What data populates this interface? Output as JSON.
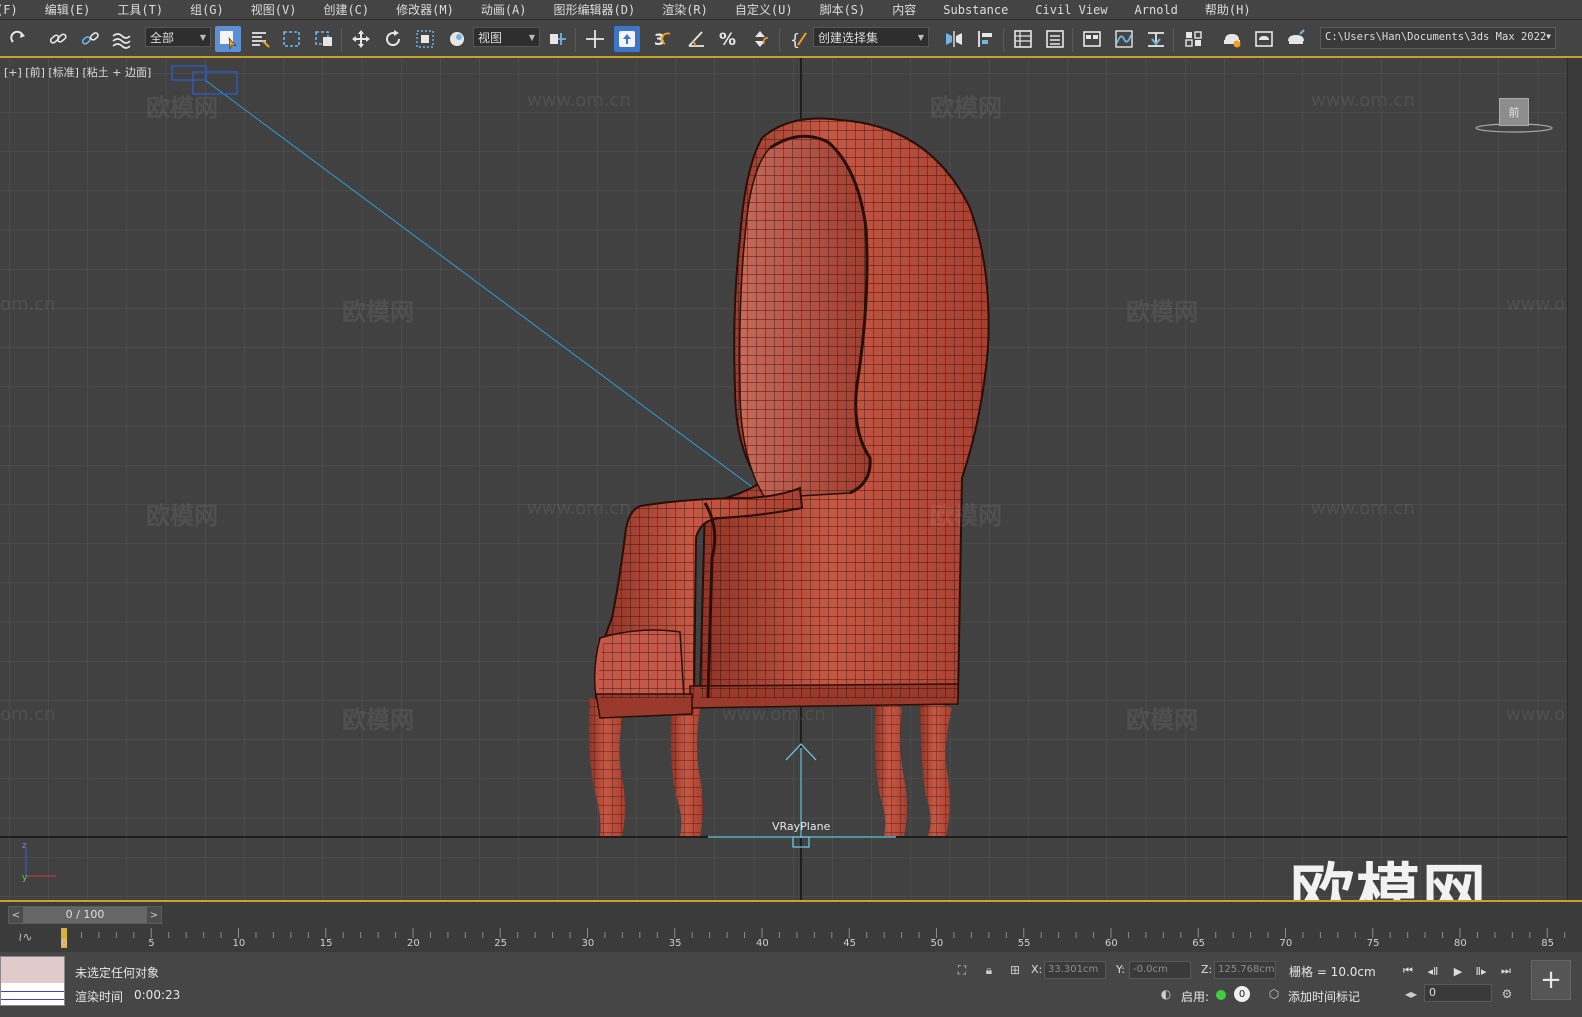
{
  "menu": {
    "items": [
      "(F)",
      "编辑(E)",
      "工具(T)",
      "组(G)",
      "视图(V)",
      "创建(C)",
      "修改器(M)",
      "动画(A)",
      "图形编辑器(D)",
      "渲染(R)",
      "自定义(U)",
      "脚本(S)",
      "内容",
      "Substance",
      "Civil View",
      "Arnold",
      "帮助(H)"
    ]
  },
  "toolbar": {
    "selection_filter": "全部",
    "ref_coord": "视图",
    "named_selection": "创建选择集",
    "project_path": "C:\\Users\\Han\\Documents\\3ds Max 2022",
    "snap_value": "3"
  },
  "viewport": {
    "label": "[+] [前] [标准] [粘土 + 边面]",
    "viewcube_label": "前",
    "object_label": "VRayPlane",
    "watermark_text": "欧模网",
    "watermark_url": "www.om.cn",
    "watermark_partial_url": "om.cn",
    "watermark_partial_url_right": "www.o",
    "logo_text": "欧模网",
    "axis_z": "z",
    "axis_y": "y"
  },
  "timeline": {
    "frame_display": "0 / 100",
    "current_frame": 0,
    "tick_labels": [
      "0",
      "5",
      "10",
      "15",
      "20",
      "25",
      "30",
      "35",
      "40",
      "45",
      "50",
      "55",
      "60",
      "65",
      "70",
      "75",
      "80",
      "85"
    ]
  },
  "status": {
    "message": "未选定任何对象",
    "render_time_label": "渲染时间",
    "render_time_value": "0:00:23",
    "x_label": "X:",
    "x_value": "33.301cm",
    "y_label": "Y:",
    "y_value": "-0.0cm",
    "z_label": "Z:",
    "z_value": "125.768cm",
    "grid": "栅格 = 10.0cm",
    "enable_label": "启用:",
    "badge_value": "0",
    "add_time_tag": "添加时间标记",
    "frame_spinner": "0"
  },
  "colors": {
    "accent_gold": "#c8a02a",
    "active_blue": "#5b8fd6",
    "chair_red": "#b5493a",
    "viewport_bg": "#414141"
  }
}
